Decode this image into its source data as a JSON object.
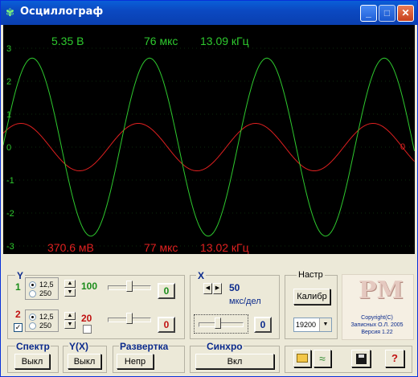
{
  "window": {
    "title": "Осциллограф"
  },
  "scope": {
    "y_ticks": [
      "3",
      "2",
      "1",
      "0",
      "-1",
      "-2",
      "-3"
    ],
    "ch1_readout": {
      "amplitude": "5.35 В",
      "period": "76 мкс",
      "frequency": "13.09 кГц",
      "color": "#2ec92e"
    },
    "ch2_readout": {
      "amplitude": "370.6 мВ",
      "period": "77 мкс",
      "frequency": "13.02 кГц",
      "color": "#e02020"
    },
    "ch2_zero_marker": "0"
  },
  "y_panel": {
    "label": "Y",
    "ch1": {
      "number": "1",
      "opt_a": "12,5",
      "opt_b": "250",
      "selected": "12,5",
      "value": "100",
      "zero_button": "0"
    },
    "ch2": {
      "number": "2",
      "opt_a": "12,5",
      "opt_b": "250",
      "selected": "12,5",
      "value": "20",
      "zero_button": "0",
      "enabled": true
    }
  },
  "x_panel": {
    "label": "X",
    "value": "50",
    "unit": "мкс/дел",
    "zero_button": "0"
  },
  "settings": {
    "label": "Настр",
    "calibrate_button": "Калибр",
    "baud": "19200"
  },
  "logo": {
    "text": "PM",
    "copyright": "Copyright(C)",
    "author": "Записных О.Л. 2005",
    "version": "Версия 1.22"
  },
  "bottom": {
    "spectrum": {
      "label": "Спектр",
      "button": "Выкл"
    },
    "yx": {
      "label": "Y(X)",
      "button": "Выкл"
    },
    "sweep": {
      "label": "Развертка",
      "button": "Непр"
    },
    "sync": {
      "label": "Синхро",
      "button": "Вкл"
    },
    "help_button": "?"
  }
}
